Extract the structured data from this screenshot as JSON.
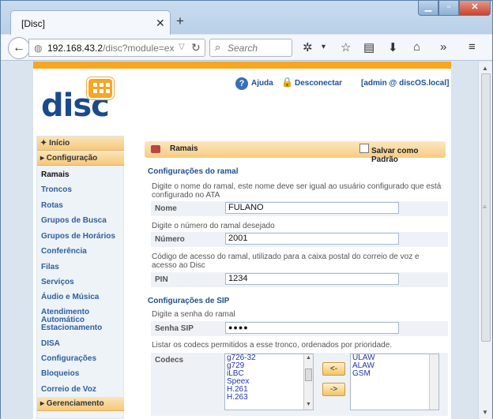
{
  "browser": {
    "tab_title": "[Disc]",
    "url_host": "192.168.43.2",
    "url_path": "/disc?module=extens",
    "search_placeholder": "Search"
  },
  "header": {
    "logo_text": "disc",
    "help": "Ajuda",
    "logout": "Desconectar",
    "user": "[admin @ discOS.local]"
  },
  "sidebar": {
    "items": [
      {
        "label": "✦ Início",
        "type": "header"
      },
      {
        "label": "▸ Configuração",
        "type": "header"
      },
      {
        "label": "Ramais",
        "type": "active"
      },
      {
        "label": "Troncos",
        "type": "item"
      },
      {
        "label": "Rotas",
        "type": "item"
      },
      {
        "label": "Grupos de Busca",
        "type": "item"
      },
      {
        "label": "Grupos de Horários",
        "type": "item"
      },
      {
        "label": "Conferência",
        "type": "item"
      },
      {
        "label": "Filas",
        "type": "item"
      },
      {
        "label": "Serviços",
        "type": "item"
      },
      {
        "label": "Áudio e Música",
        "type": "item"
      },
      {
        "label": "Atendimento Automático",
        "type": "item"
      },
      {
        "label": "Estacionamento",
        "type": "item"
      },
      {
        "label": "DISA",
        "type": "item"
      },
      {
        "label": "Configurações",
        "type": "item"
      },
      {
        "label": "Bloqueios",
        "type": "item"
      },
      {
        "label": "Correio de Voz",
        "type": "item"
      },
      {
        "label": "▸ Gerenciamento",
        "type": "header"
      }
    ]
  },
  "main": {
    "title": "Ramais",
    "save_default": "Salvar como Padrão",
    "section_extension": "Configurações do ramal",
    "name_help": "Digite o nome do ramal, este nome deve ser igual ao usuário configurado que está configurado no ATA",
    "name_label": "Nome",
    "name_value": "FULANO",
    "number_help": "Digite o número do ramal desejado",
    "number_label": "Número",
    "number_value": "2001",
    "pin_help": "Código de acesso do ramal, utilizado para a caixa postal do correio de voz e acesso ao Disc",
    "pin_label": "PIN",
    "pin_value": "1234",
    "section_sip": "Configurações de SIP",
    "sip_help": "Digite a senha do ramal",
    "sip_label": "Senha SIP",
    "sip_value": "●●●●",
    "codec_help": "Listar os codecs permitidos a esse tronco, ordenados por prioridade.",
    "codec_label": "Codecs",
    "codecs_available": [
      "g726-32",
      "g729",
      "iLBC",
      "Speex",
      "H.261",
      "H.263"
    ],
    "codecs_selected": [
      "ULAW",
      "ALAW",
      "GSM"
    ],
    "move_left": "<-",
    "move_right": "->"
  }
}
